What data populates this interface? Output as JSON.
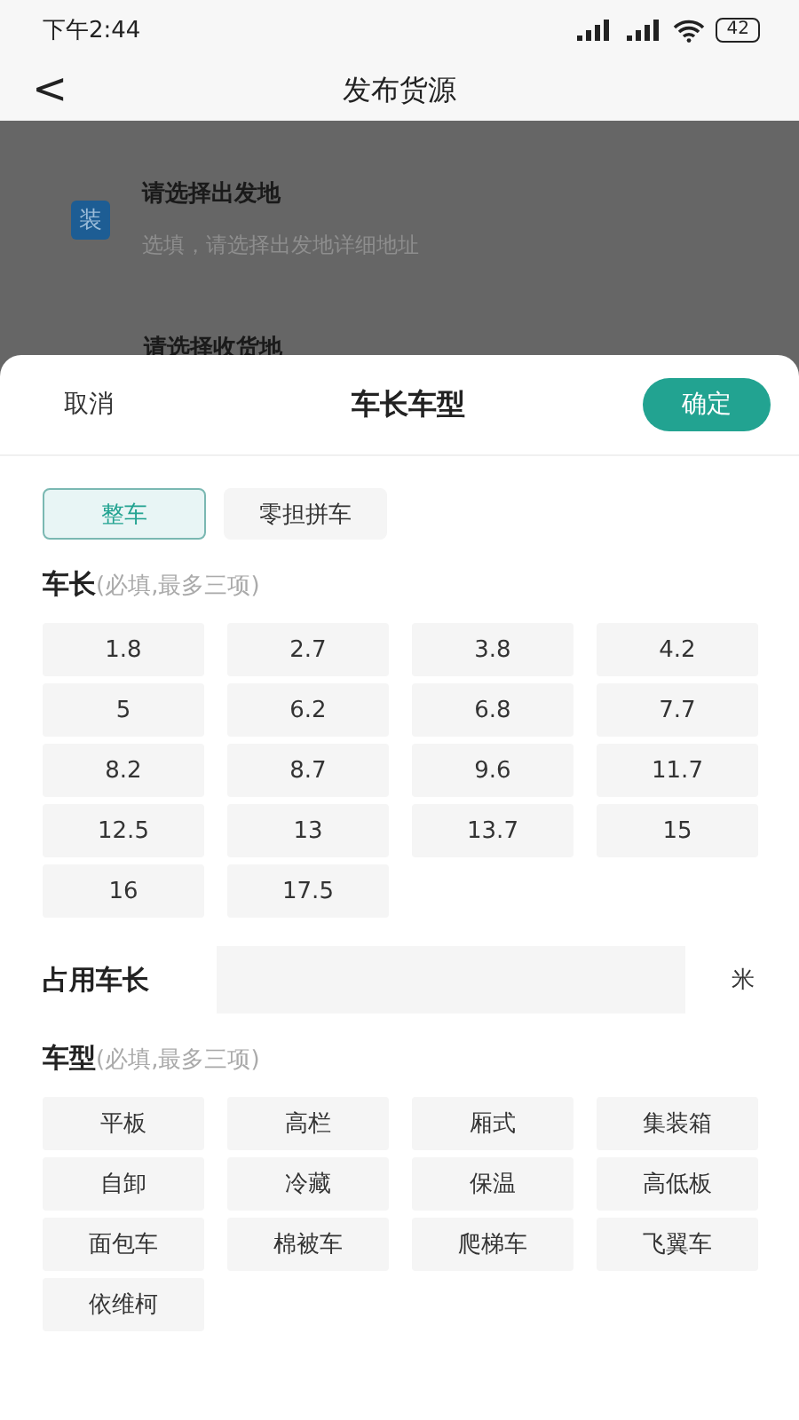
{
  "status_bar": {
    "time": "下午2:44",
    "battery": "42"
  },
  "nav": {
    "back": "<",
    "title": "发布货源"
  },
  "background_form": {
    "badge": "装",
    "origin_title": "请选择出发地",
    "origin_hint": "选填，请选择出发地详细地址",
    "destination_title": "请选择收货地"
  },
  "sheet": {
    "cancel": "取消",
    "title": "车长车型",
    "confirm": "确定",
    "tabs": [
      {
        "label": "整车",
        "selected": true
      },
      {
        "label": "零担拼车",
        "selected": false
      }
    ],
    "length_heading": "车长",
    "length_note": "(必填,最多三项)",
    "lengths": [
      {
        "label": "1.8",
        "selected": false
      },
      {
        "label": "2.7",
        "selected": false
      },
      {
        "label": "3.8",
        "selected": false
      },
      {
        "label": "4.2",
        "selected": false
      },
      {
        "label": "5",
        "selected": false
      },
      {
        "label": "6.2",
        "selected": false
      },
      {
        "label": "6.8",
        "selected": false
      },
      {
        "label": "7.7",
        "selected": false
      },
      {
        "label": "8.2",
        "selected": false
      },
      {
        "label": "8.7",
        "selected": false
      },
      {
        "label": "9.6",
        "selected": false
      },
      {
        "label": "11.7",
        "selected": false
      },
      {
        "label": "12.5",
        "selected": false
      },
      {
        "label": "13",
        "selected": false
      },
      {
        "label": "13.7",
        "selected": false
      },
      {
        "label": "15",
        "selected": false
      },
      {
        "label": "16",
        "selected": false
      },
      {
        "label": "17.5",
        "selected": false
      }
    ],
    "occupied_label": "占用车长",
    "occupied_unit": "米",
    "type_heading": "车型",
    "type_note": "(必填,最多三项)",
    "types": [
      {
        "label": "平板",
        "selected": false
      },
      {
        "label": "高栏",
        "selected": false
      },
      {
        "label": "厢式",
        "selected": false
      },
      {
        "label": "集装箱",
        "selected": false
      },
      {
        "label": "自卸",
        "selected": false
      },
      {
        "label": "冷藏",
        "selected": false
      },
      {
        "label": "保温",
        "selected": false
      },
      {
        "label": "高低板",
        "selected": false
      },
      {
        "label": "面包车",
        "selected": false
      },
      {
        "label": "棉被车",
        "selected": false
      },
      {
        "label": "爬梯车",
        "selected": false
      },
      {
        "label": "飞翼车",
        "selected": false
      },
      {
        "label": "依维柯",
        "selected": false
      }
    ]
  }
}
